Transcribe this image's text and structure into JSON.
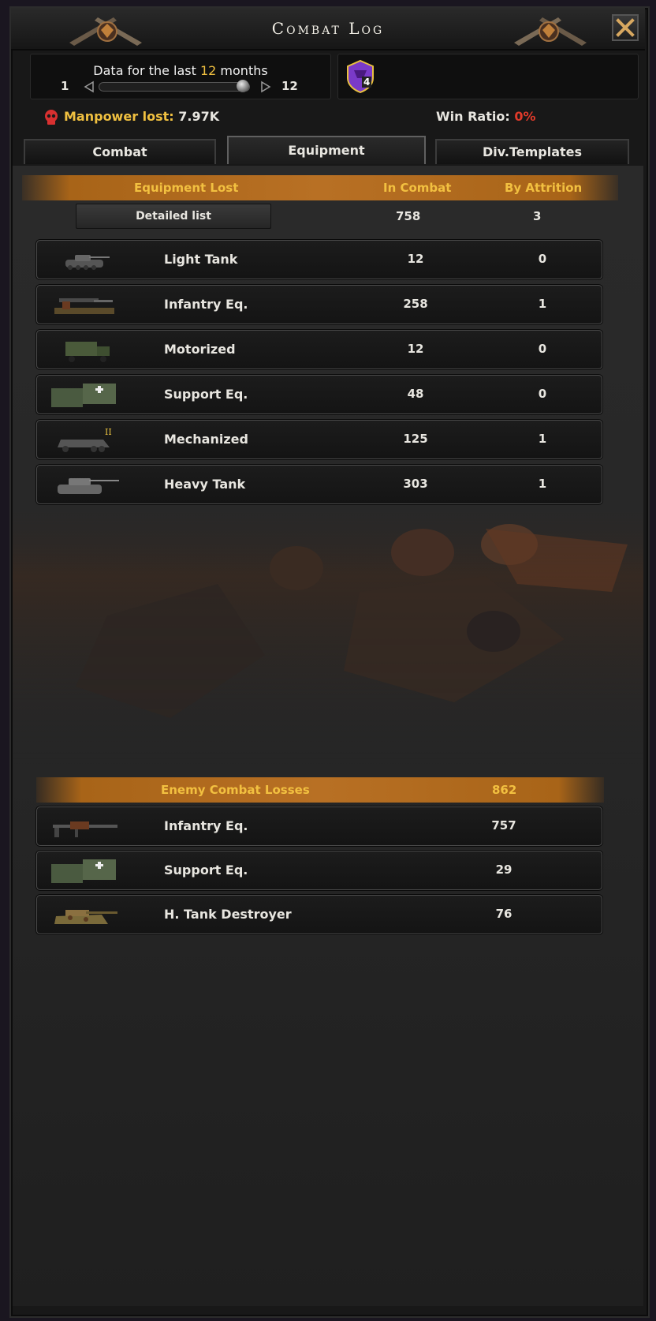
{
  "window": {
    "title": "Combat Log",
    "close_icon": "close-x-icon"
  },
  "time_filter": {
    "label_prefix": "Data for the last",
    "months": "12",
    "label_suffix": "months",
    "min": "1",
    "max": "12",
    "value_fraction": 1.0
  },
  "badge": {
    "icon": "purple-shield-badge-icon",
    "value": "4"
  },
  "stats": {
    "manpower_label": "Manpower lost:",
    "manpower_value": "7.97K",
    "win_label": "Win Ratio:",
    "win_value": "0%"
  },
  "tabs": [
    {
      "label": "Combat",
      "active": false
    },
    {
      "label": "Equipment",
      "active": true
    },
    {
      "label": "Div.Templates",
      "active": false
    }
  ],
  "equipment_lost": {
    "header": {
      "col1": "Equipment Lost",
      "col2": "In Combat",
      "col3": "By Attrition"
    },
    "detail_button": "Detailed list",
    "total_in_combat": "758",
    "total_by_attrition": "3",
    "rows": [
      {
        "icon": "light-tank-icon",
        "name": "Light Tank",
        "in_combat": "12",
        "by_attrition": "0"
      },
      {
        "icon": "infantry-equipment-icon",
        "name": "Infantry Eq.",
        "in_combat": "258",
        "by_attrition": "1"
      },
      {
        "icon": "motorized-truck-icon",
        "name": "Motorized",
        "in_combat": "12",
        "by_attrition": "0"
      },
      {
        "icon": "support-equipment-icon",
        "name": "Support Eq.",
        "in_combat": "48",
        "by_attrition": "0"
      },
      {
        "icon": "mechanized-halftrack-icon",
        "name": "Mechanized",
        "in_combat": "125",
        "by_attrition": "1"
      },
      {
        "icon": "heavy-tank-icon",
        "name": "Heavy Tank",
        "in_combat": "303",
        "by_attrition": "1"
      }
    ]
  },
  "enemy_losses": {
    "header": {
      "label": "Enemy Combat Losses",
      "total": "862"
    },
    "rows": [
      {
        "icon": "infantry-rifle-icon",
        "name": "Infantry Eq.",
        "value": "757"
      },
      {
        "icon": "support-equipment-icon",
        "name": "Support Eq.",
        "value": "29"
      },
      {
        "icon": "tank-destroyer-icon",
        "name": "H. Tank Destroyer",
        "value": "76"
      }
    ]
  },
  "colors": {
    "accent_gold": "#f0c040",
    "header_bar": "#b87024",
    "danger_red": "#e03a2a"
  }
}
